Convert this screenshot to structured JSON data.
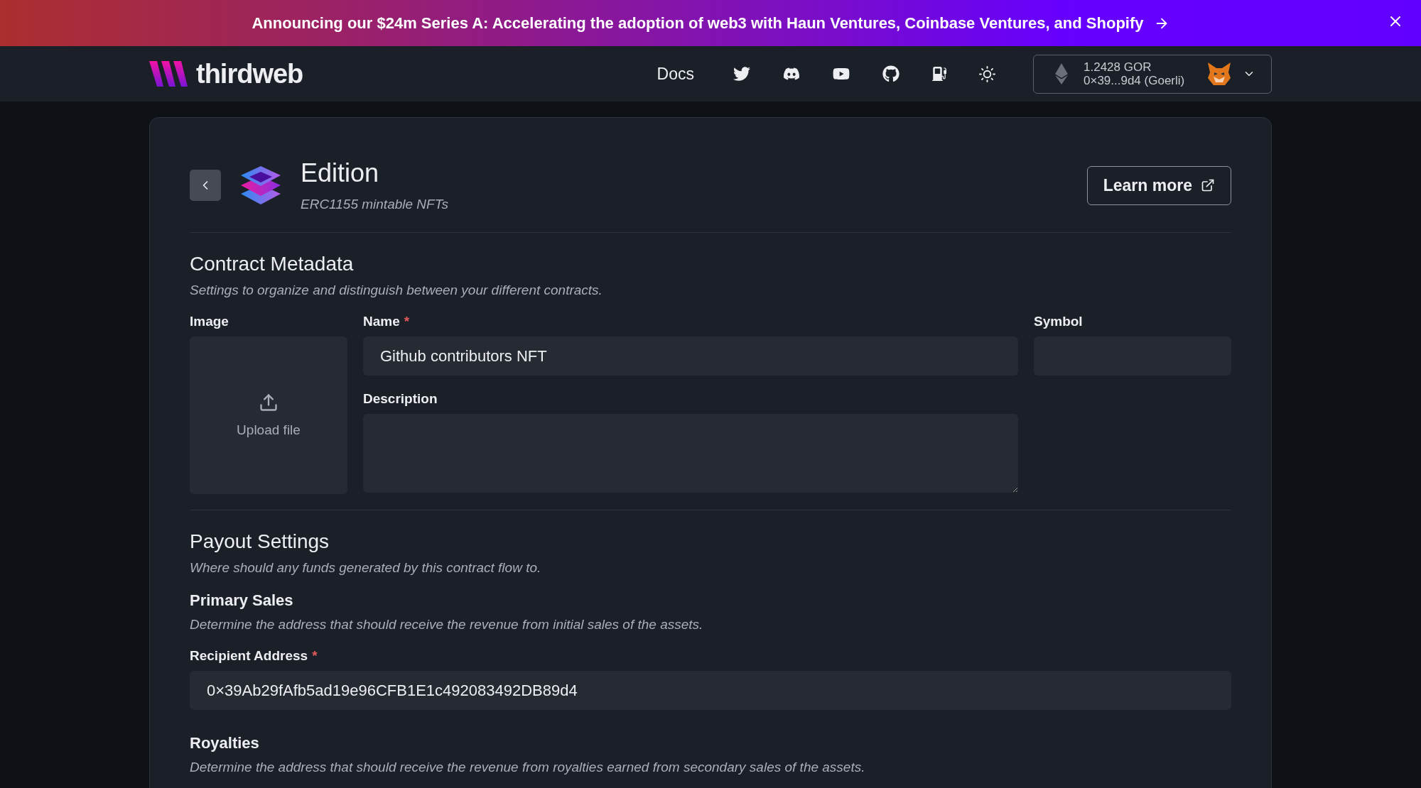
{
  "banner": {
    "text": "Announcing our $24m Series A: Accelerating the adoption of web3 with Haun Ventures, Coinbase Ventures, and Shopify"
  },
  "nav": {
    "brand": "thirdweb",
    "links": [
      {
        "label": "Docs"
      }
    ],
    "wallet": {
      "balance": "1.2428 GOR",
      "address": "0×39...9d4 (Goerli)"
    }
  },
  "header": {
    "title": "Edition",
    "subtitle": "ERC1155 mintable NFTs",
    "learn_more": "Learn more"
  },
  "contract_metadata": {
    "title": "Contract Metadata",
    "subtitle": "Settings to organize and distinguish between your different contracts.",
    "image": {
      "label": "Image",
      "upload": "Upload file"
    },
    "name": {
      "label": "Name",
      "required_mark": "*",
      "value": "Github contributors NFT"
    },
    "symbol": {
      "label": "Symbol"
    },
    "description": {
      "label": "Description"
    }
  },
  "payout": {
    "title": "Payout Settings",
    "subtitle": "Where should any funds generated by this contract flow to.",
    "primary_sales": {
      "title": "Primary Sales",
      "description": "Determine the address that should receive the revenue from initial sales of the assets.",
      "recipient": {
        "label": "Recipient Address",
        "required_mark": "*",
        "value": "0×39Ab29fAfb5ad19e96CFB1E1c492083492DB89d4"
      }
    },
    "royalties": {
      "title": "Royalties",
      "description": "Determine the address that should receive the revenue from royalties earned from secondary sales of the assets."
    }
  }
}
